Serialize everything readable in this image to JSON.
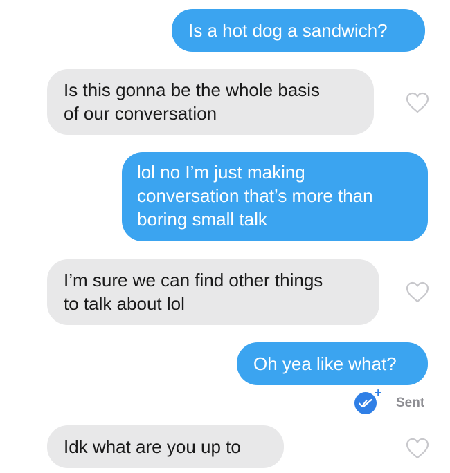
{
  "messages": [
    {
      "from": "me",
      "text": "Is a hot dog a sandwich?"
    },
    {
      "from": "them",
      "text": "Is this gonna be the whole basis\nof our conversation"
    },
    {
      "from": "me",
      "text": "lol no I’m just making\nconversation that’s more than\nboring small talk"
    },
    {
      "from": "them",
      "text": "I’m sure we can find other things\nto talk about lol"
    },
    {
      "from": "me",
      "text": "Oh yea like what?"
    },
    {
      "from": "them",
      "text": "Idk what are you up to"
    }
  ],
  "status": {
    "label": "Sent",
    "icon": "double-check-icon",
    "plus_glyph": "+"
  },
  "colors": {
    "outgoing_bubble": "#3ba4f0",
    "incoming_bubble": "#e8e8e9",
    "status_blue": "#2f7fe6",
    "heart_outline": "#c8c8cc"
  }
}
